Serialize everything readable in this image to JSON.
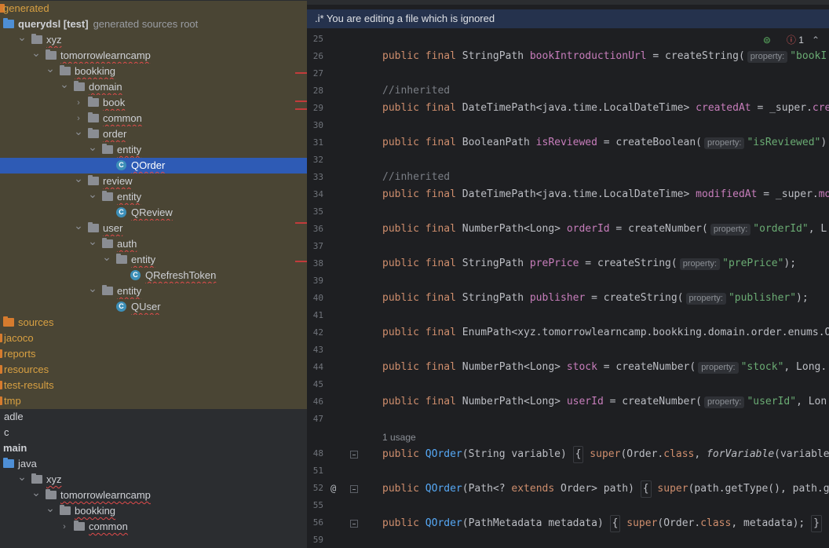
{
  "tree": {
    "rows": [
      {
        "label": "generated",
        "hint": "",
        "icon": "folder-icon",
        "chevron": "",
        "indent": -1,
        "style": "gen-orange",
        "name": "tree-item-generated"
      },
      {
        "label": "querydsl [test]",
        "hint": "generated sources root",
        "icon": "source-root-icon",
        "chevron": "",
        "indent": 0,
        "style": "gen-bold",
        "name": "tree-item-querydsl"
      },
      {
        "label": "xyz",
        "hint": "",
        "icon": "package-icon",
        "chevron": "down",
        "indent": 1,
        "style": "gen",
        "name": "tree-item-xyz"
      },
      {
        "label": "tomorrowlearncamp",
        "hint": "",
        "icon": "package-icon",
        "chevron": "down",
        "indent": 2,
        "style": "gen",
        "name": "tree-item-tomorrowlearncamp"
      },
      {
        "label": "bookking",
        "hint": "",
        "icon": "package-icon",
        "chevron": "down",
        "indent": 3,
        "style": "gen",
        "name": "tree-item-bookking"
      },
      {
        "label": "domain",
        "hint": "",
        "icon": "package-icon",
        "chevron": "down",
        "indent": 4,
        "style": "gen",
        "name": "tree-item-domain"
      },
      {
        "label": "book",
        "hint": "",
        "icon": "package-icon",
        "chevron": "right",
        "indent": 5,
        "style": "gen",
        "name": "tree-item-book"
      },
      {
        "label": "common",
        "hint": "",
        "icon": "package-icon",
        "chevron": "right",
        "indent": 5,
        "style": "gen",
        "name": "tree-item-common"
      },
      {
        "label": "order",
        "hint": "",
        "icon": "package-icon",
        "chevron": "down",
        "indent": 5,
        "style": "gen",
        "name": "tree-item-order"
      },
      {
        "label": "entity",
        "hint": "",
        "icon": "package-icon",
        "chevron": "down",
        "indent": 6,
        "style": "gen",
        "name": "tree-item-order-entity"
      },
      {
        "label": "QOrder",
        "hint": "",
        "icon": "class-icon",
        "chevron": "",
        "indent": 7,
        "style": "sel",
        "name": "tree-item-qorder"
      },
      {
        "label": "review",
        "hint": "",
        "icon": "package-icon",
        "chevron": "down",
        "indent": 5,
        "style": "gen",
        "name": "tree-item-review"
      },
      {
        "label": "entity",
        "hint": "",
        "icon": "package-icon",
        "chevron": "down",
        "indent": 6,
        "style": "gen",
        "name": "tree-item-review-entity"
      },
      {
        "label": "QReview",
        "hint": "",
        "icon": "class-icon",
        "chevron": "",
        "indent": 7,
        "style": "gen",
        "name": "tree-item-qreview"
      },
      {
        "label": "user",
        "hint": "",
        "icon": "package-icon",
        "chevron": "down",
        "indent": 5,
        "style": "gen",
        "name": "tree-item-user"
      },
      {
        "label": "auth",
        "hint": "",
        "icon": "package-icon",
        "chevron": "down",
        "indent": 6,
        "style": "gen",
        "name": "tree-item-auth"
      },
      {
        "label": "entity",
        "hint": "",
        "icon": "package-icon",
        "chevron": "down",
        "indent": 7,
        "style": "gen",
        "name": "tree-item-auth-entity"
      },
      {
        "label": "QRefreshToken",
        "hint": "",
        "icon": "class-icon",
        "chevron": "",
        "indent": 8,
        "style": "gen",
        "name": "tree-item-qrefreshtoken"
      },
      {
        "label": "entity",
        "hint": "",
        "icon": "package-icon",
        "chevron": "down",
        "indent": 6,
        "style": "gen",
        "name": "tree-item-user-entity"
      },
      {
        "label": "QUser",
        "hint": "",
        "icon": "class-icon",
        "chevron": "",
        "indent": 7,
        "style": "gen",
        "name": "tree-item-quser"
      },
      {
        "label": "sources",
        "hint": "",
        "icon": "folder-icon",
        "chevron": "",
        "indent": 0,
        "style": "gen-orange",
        "name": "tree-item-sources"
      },
      {
        "label": "jacoco",
        "hint": "",
        "icon": "",
        "chevron": "",
        "indent": -1,
        "style": "gen-orange",
        "name": "tree-item-jacoco"
      },
      {
        "label": "reports",
        "hint": "",
        "icon": "",
        "chevron": "",
        "indent": -1,
        "style": "gen-orange",
        "name": "tree-item-reports"
      },
      {
        "label": "resources",
        "hint": "",
        "icon": "",
        "chevron": "",
        "indent": -1,
        "style": "gen-orange",
        "name": "tree-item-resources"
      },
      {
        "label": "test-results",
        "hint": "",
        "icon": "",
        "chevron": "",
        "indent": -1,
        "style": "gen-orange",
        "name": "tree-item-test-results"
      },
      {
        "label": "tmp",
        "hint": "",
        "icon": "",
        "chevron": "",
        "indent": -1,
        "style": "gen-orange",
        "name": "tree-item-tmp"
      },
      {
        "label": "adle",
        "hint": "",
        "icon": "",
        "chevron": "",
        "indent": -1,
        "style": "plain",
        "name": "tree-item-gradle"
      },
      {
        "label": "c",
        "hint": "",
        "icon": "",
        "chevron": "",
        "indent": -1,
        "style": "plain",
        "name": "tree-item-src"
      },
      {
        "label": "main",
        "hint": "",
        "icon": "",
        "chevron": "",
        "indent": -1,
        "style": "bold",
        "name": "tree-item-main"
      },
      {
        "label": "java",
        "hint": "",
        "icon": "source-folder-icon",
        "chevron": "",
        "indent": 0,
        "style": "plain",
        "name": "tree-item-java"
      },
      {
        "label": "xyz",
        "hint": "",
        "icon": "package-icon",
        "chevron": "down",
        "indent": 1,
        "style": "plain",
        "name": "tree-item-main-xyz"
      },
      {
        "label": "tomorrowlearncamp",
        "hint": "",
        "icon": "package-icon",
        "chevron": "down",
        "indent": 2,
        "style": "plain",
        "name": "tree-item-main-tomorrowlearncamp"
      },
      {
        "label": "bookking",
        "hint": "",
        "icon": "package-icon",
        "chevron": "down",
        "indent": 3,
        "style": "plain",
        "name": "tree-item-main-bookking"
      },
      {
        "label": "common",
        "hint": "",
        "icon": "package-icon",
        "chevron": "right",
        "indent": 4,
        "style": "plain",
        "name": "tree-item-main-common"
      }
    ]
  },
  "editor": {
    "banner_text": ".i* You are editing a file which is ignored",
    "inspection": {
      "errors": "1"
    },
    "lines": [
      {
        "n": "25",
        "parts": []
      },
      {
        "n": "26",
        "parts": [
          [
            "kw",
            "public final "
          ],
          [
            "t",
            "StringPath "
          ],
          [
            "fld",
            "bookIntroductionUrl"
          ],
          [
            "t",
            " = createString("
          ],
          [
            "ph",
            "property:"
          ],
          [
            "str",
            "\"bookI"
          ]
        ]
      },
      {
        "n": "27",
        "parts": []
      },
      {
        "n": "28",
        "parts": [
          [
            "cm",
            "//inherited"
          ]
        ]
      },
      {
        "n": "29",
        "parts": [
          [
            "kw",
            "public final "
          ],
          [
            "t",
            "DateTimePath<java.time.LocalDateTime> "
          ],
          [
            "fld",
            "createdAt"
          ],
          [
            "t",
            " = _super."
          ],
          [
            "fld",
            "cre"
          ]
        ]
      },
      {
        "n": "30",
        "parts": []
      },
      {
        "n": "31",
        "parts": [
          [
            "kw",
            "public final "
          ],
          [
            "t",
            "BooleanPath "
          ],
          [
            "fld",
            "isReviewed"
          ],
          [
            "t",
            " = createBoolean("
          ],
          [
            "ph",
            "property:"
          ],
          [
            "str",
            "\"isReviewed\""
          ],
          [
            "t",
            ")"
          ]
        ]
      },
      {
        "n": "32",
        "parts": []
      },
      {
        "n": "33",
        "parts": [
          [
            "cm",
            "//inherited"
          ]
        ]
      },
      {
        "n": "34",
        "parts": [
          [
            "kw",
            "public final "
          ],
          [
            "t",
            "DateTimePath<java.time.LocalDateTime> "
          ],
          [
            "fld",
            "modifiedAt"
          ],
          [
            "t",
            " = _super."
          ],
          [
            "fld",
            "mo"
          ]
        ]
      },
      {
        "n": "35",
        "parts": []
      },
      {
        "n": "36",
        "parts": [
          [
            "kw",
            "public final "
          ],
          [
            "t",
            "NumberPath<Long> "
          ],
          [
            "fld",
            "orderId"
          ],
          [
            "t",
            " = createNumber("
          ],
          [
            "ph",
            "property:"
          ],
          [
            "str",
            "\"orderId\""
          ],
          [
            "t",
            ", L"
          ]
        ]
      },
      {
        "n": "37",
        "parts": []
      },
      {
        "n": "38",
        "parts": [
          [
            "kw",
            "public final "
          ],
          [
            "t",
            "StringPath "
          ],
          [
            "fld",
            "prePrice"
          ],
          [
            "t",
            " = createString("
          ],
          [
            "ph",
            "property:"
          ],
          [
            "str",
            "\"prePrice\""
          ],
          [
            "t",
            ");"
          ]
        ]
      },
      {
        "n": "39",
        "parts": []
      },
      {
        "n": "40",
        "parts": [
          [
            "kw",
            "public final "
          ],
          [
            "t",
            "StringPath "
          ],
          [
            "fld",
            "publisher"
          ],
          [
            "t",
            " = createString("
          ],
          [
            "ph",
            "property:"
          ],
          [
            "str",
            "\"publisher\""
          ],
          [
            "t",
            ");"
          ]
        ]
      },
      {
        "n": "41",
        "parts": []
      },
      {
        "n": "42",
        "parts": [
          [
            "kw",
            "public final "
          ],
          [
            "t",
            "EnumPath<xyz.tomorrowlearncamp.bookking.domain.order.enums.O"
          ]
        ]
      },
      {
        "n": "43",
        "parts": []
      },
      {
        "n": "44",
        "parts": [
          [
            "kw",
            "public final "
          ],
          [
            "t",
            "NumberPath<Long> "
          ],
          [
            "fld",
            "stock"
          ],
          [
            "t",
            " = createNumber("
          ],
          [
            "ph",
            "property:"
          ],
          [
            "str",
            "\"stock\""
          ],
          [
            "t",
            ", Long."
          ]
        ]
      },
      {
        "n": "45",
        "parts": []
      },
      {
        "n": "46",
        "parts": [
          [
            "kw",
            "public final "
          ],
          [
            "t",
            "NumberPath<Long> "
          ],
          [
            "fld",
            "userId"
          ],
          [
            "t",
            " = createNumber("
          ],
          [
            "ph",
            "property:"
          ],
          [
            "str",
            "\"userId\""
          ],
          [
            "t",
            ", Lon"
          ]
        ]
      },
      {
        "n": "47",
        "parts": []
      },
      {
        "n": "",
        "usage": "1 usage",
        "parts": []
      },
      {
        "n": "48",
        "fold": true,
        "parts": [
          [
            "kw",
            "public "
          ],
          [
            "fn",
            "QOrder"
          ],
          [
            "t",
            "(String variable) "
          ],
          [
            "box",
            "{"
          ],
          [
            "kw",
            " super"
          ],
          [
            "t",
            "(Order."
          ],
          [
            "kw",
            "class"
          ],
          [
            "t",
            ", "
          ],
          [
            "it",
            "forVariable"
          ],
          [
            "t",
            "(variable)"
          ]
        ]
      },
      {
        "n": "51",
        "parts": []
      },
      {
        "n": "52",
        "at": "@",
        "fold": true,
        "parts": [
          [
            "kw",
            "public "
          ],
          [
            "fn",
            "QOrder"
          ],
          [
            "t",
            "(Path<? "
          ],
          [
            "kw",
            "extends"
          ],
          [
            "t",
            " Order> path) "
          ],
          [
            "box",
            "{"
          ],
          [
            "kw",
            " super"
          ],
          [
            "t",
            "(path.getType(), path.ge"
          ]
        ]
      },
      {
        "n": "55",
        "parts": []
      },
      {
        "n": "56",
        "fold": true,
        "parts": [
          [
            "kw",
            "public "
          ],
          [
            "fn",
            "QOrder"
          ],
          [
            "t",
            "(PathMetadata metadata) "
          ],
          [
            "box",
            "{"
          ],
          [
            "kw",
            " super"
          ],
          [
            "t",
            "(Order."
          ],
          [
            "kw",
            "class"
          ],
          [
            "t",
            ", metadata); "
          ],
          [
            "box",
            "}"
          ]
        ]
      },
      {
        "n": "59",
        "parts": []
      }
    ]
  },
  "colors": {
    "accent": "#3574f0",
    "selection": "#2e5bb5",
    "ignored_bg": "#4a4534"
  }
}
